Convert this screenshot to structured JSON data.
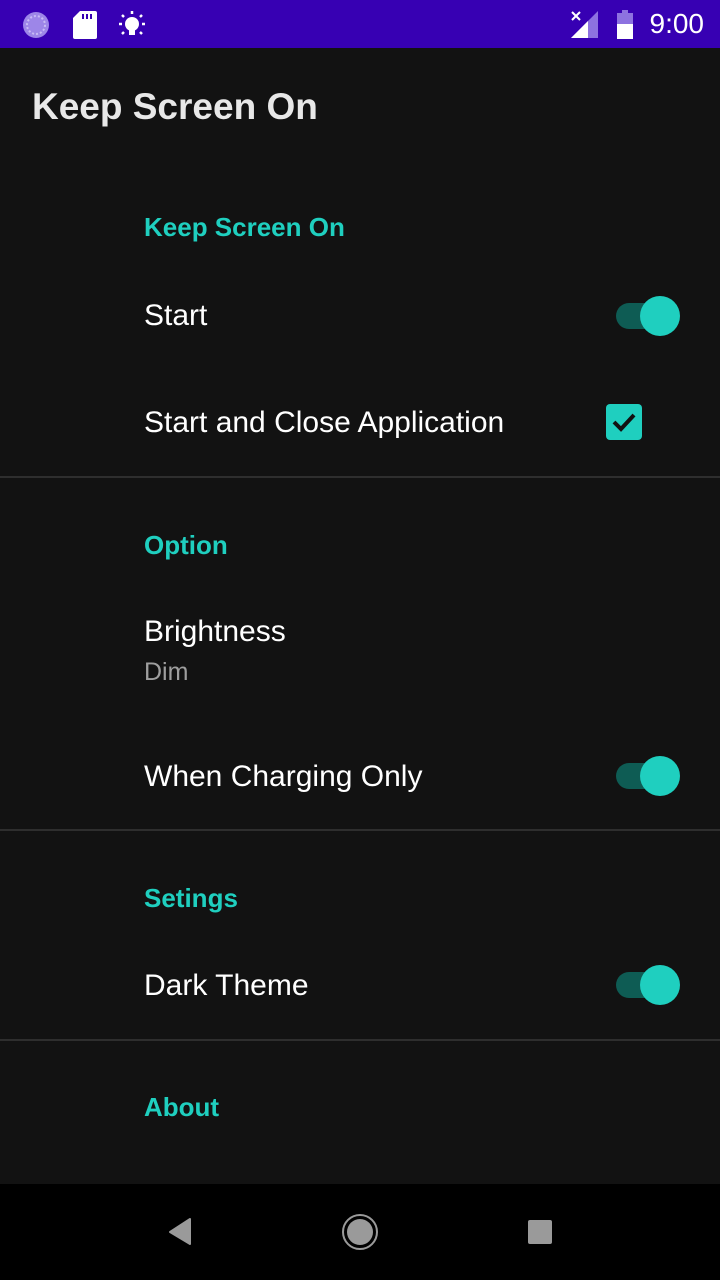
{
  "status_bar": {
    "time": "9:00",
    "icons_left": [
      "sync-icon",
      "sd-card-icon",
      "brightness-icon"
    ],
    "icons_right": [
      "no-signal-icon",
      "battery-icon"
    ]
  },
  "app_bar": {
    "title": "Keep Screen On"
  },
  "sections": [
    {
      "header": "Keep Screen On",
      "items": [
        {
          "title": "Start",
          "control": "switch",
          "checked": true
        },
        {
          "title": "Start and Close Application",
          "control": "checkbox",
          "checked": true
        }
      ]
    },
    {
      "header": "Option",
      "items": [
        {
          "title": "Brightness",
          "summary": "Dim"
        },
        {
          "title": "When Charging Only",
          "control": "switch",
          "checked": true
        }
      ]
    },
    {
      "header": "Setings",
      "items": [
        {
          "title": "Dark Theme",
          "control": "switch",
          "checked": true
        }
      ]
    },
    {
      "header": "About",
      "items": []
    }
  ],
  "nav_bar": {
    "buttons": [
      "back",
      "home",
      "recents"
    ]
  },
  "colors": {
    "accent": "#1fcfbf",
    "status_bar": "#3700b3",
    "background": "#121212"
  }
}
